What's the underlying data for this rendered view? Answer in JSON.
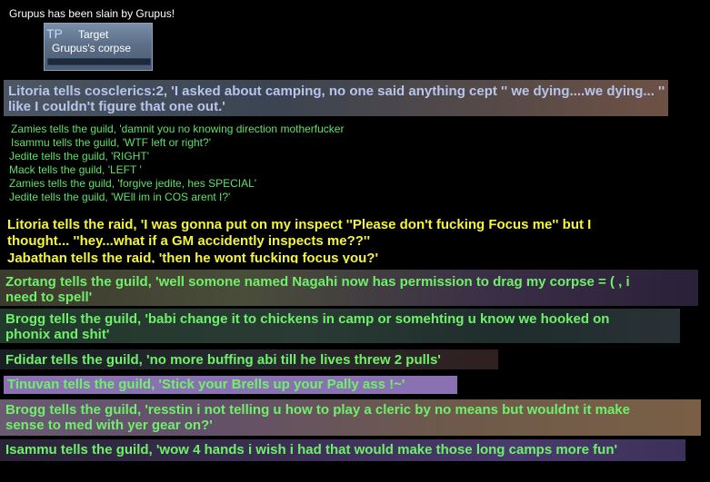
{
  "system_message": "Grupus has been slain by Grupus!",
  "target": {
    "icon": "TP",
    "label": "Target",
    "name": "Grupus's corpse",
    "health_fraction": 0.0
  },
  "litoria_tell": "Litoria tells cosclerics:2, 'I asked about camping, no one said anything cept '' we dying....we dying... '' like I couldn't figure that one out.'",
  "guild_small": [
    "Zamies tells the guild, 'damnit you no knowing direction motherfucker",
    "Isammu tells the guild, 'WTF left or right?'",
    "Jedite tells the guild, 'RIGHT'",
    "Mack tells the guild, 'LEFT '",
    "Zamies tells the guild, 'forgive jedite, hes SPECIAL'",
    "Jedite tells the guild, 'WEll im in COS arent I?'"
  ],
  "raid": {
    "line1": "Litoria tells the raid, 'I was gonna put on my inspect ''Please don't fucking Focus me'' but I",
    "line2": "thought... ''hey...what if a GM accidently inspects me??''",
    "line3": "Jabathan tells the raid, 'then he wont fucking focus you?'"
  },
  "guild_big": {
    "zortang_1": "Zortang tells the guild, 'well somone named Nagahi now has permission to drag my corpse = ( , i",
    "zortang_2": "need to spell'",
    "brogg1_1": "Brogg tells the guild, 'babi change it to chickens in camp or somehting u know we hooked on",
    "brogg1_2": "phonix and shit'",
    "fdidar": "Fdidar tells the guild, 'no more buffing abi till he lives threw 2 pulls'",
    "tinuvan": "Tinuvan tells the guild, 'Stick your Brells up your Pally ass !~'",
    "brogg2_1": "Brogg tells the guild, 'resstin i not telling u how to play a cleric by no means but wouldnt it make",
    "brogg2_2": "sense to med with yer gear on?'",
    "isammu": "Isammu tells the guild, 'wow 4 hands i wish i had that would make those long camps more fun'"
  },
  "colors": {
    "system": "#ffffff",
    "guild": "#6ff06a",
    "raid": "#f5f53c",
    "channel": "#b7c4ec"
  }
}
